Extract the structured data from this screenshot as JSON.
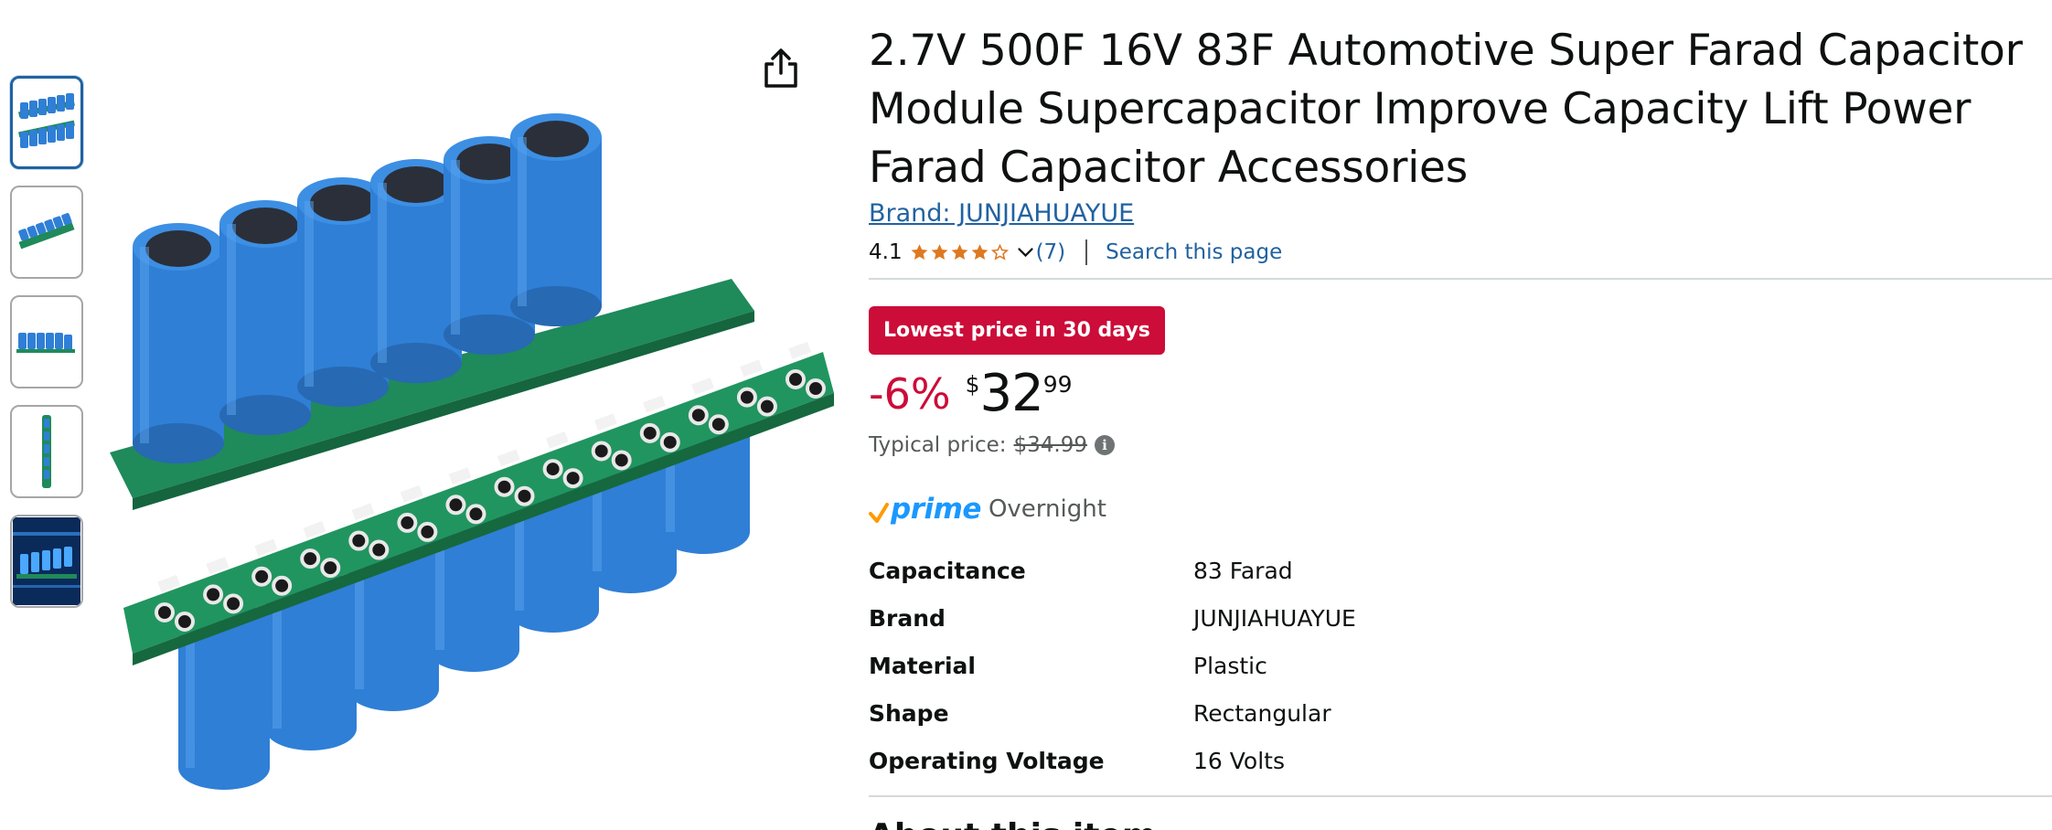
{
  "thumbnails": [
    {
      "alt": "Capacitor module front view",
      "selected": true
    },
    {
      "alt": "Capacitor module side view",
      "selected": false
    },
    {
      "alt": "Capacitor row view",
      "selected": false
    },
    {
      "alt": "Capacitor module end view",
      "selected": false
    },
    {
      "alt": "Capacitor module lifestyle image",
      "selected": false
    }
  ],
  "product": {
    "title": "2.7V 500F 16V 83F Automotive Super Farad Capacitor Module Supercapacitor Improve Capacity Lift Power Farad Capacitor Accessories",
    "brand_link": "Brand: JUNJIAHUAYUE",
    "rating": "4.1",
    "rating_count": "(7)",
    "search_page": "Search this page",
    "deal_badge": "Lowest price in 30 days",
    "discount": "-6%",
    "currency": "$",
    "price_whole": "32",
    "price_fraction": "99",
    "typical_label": "Typical price:",
    "typical_price": "$34.99",
    "prime_label": "prime",
    "prime_delivery": "Overnight",
    "specs": [
      {
        "key": "Capacitance",
        "value": "83 Farad"
      },
      {
        "key": "Brand",
        "value": "JUNJIAHUAYUE"
      },
      {
        "key": "Material",
        "value": "Plastic"
      },
      {
        "key": "Shape",
        "value": "Rectangular"
      },
      {
        "key": "Operating Voltage",
        "value": "16 Volts"
      }
    ],
    "about_heading": "About this item"
  },
  "icons": {
    "share": "share-icon",
    "star": "star-icon",
    "chevron": "chevron-down-icon",
    "info": "info-icon",
    "prime_check": "prime-check-icon"
  },
  "colors": {
    "link": "#2162a1",
    "badge": "#cc0c39",
    "discount": "#cc0c39",
    "star": "#de7921",
    "prime": "#1a98ff",
    "capacitor": "#2f7fd6",
    "pcb": "#1f8a5a"
  }
}
